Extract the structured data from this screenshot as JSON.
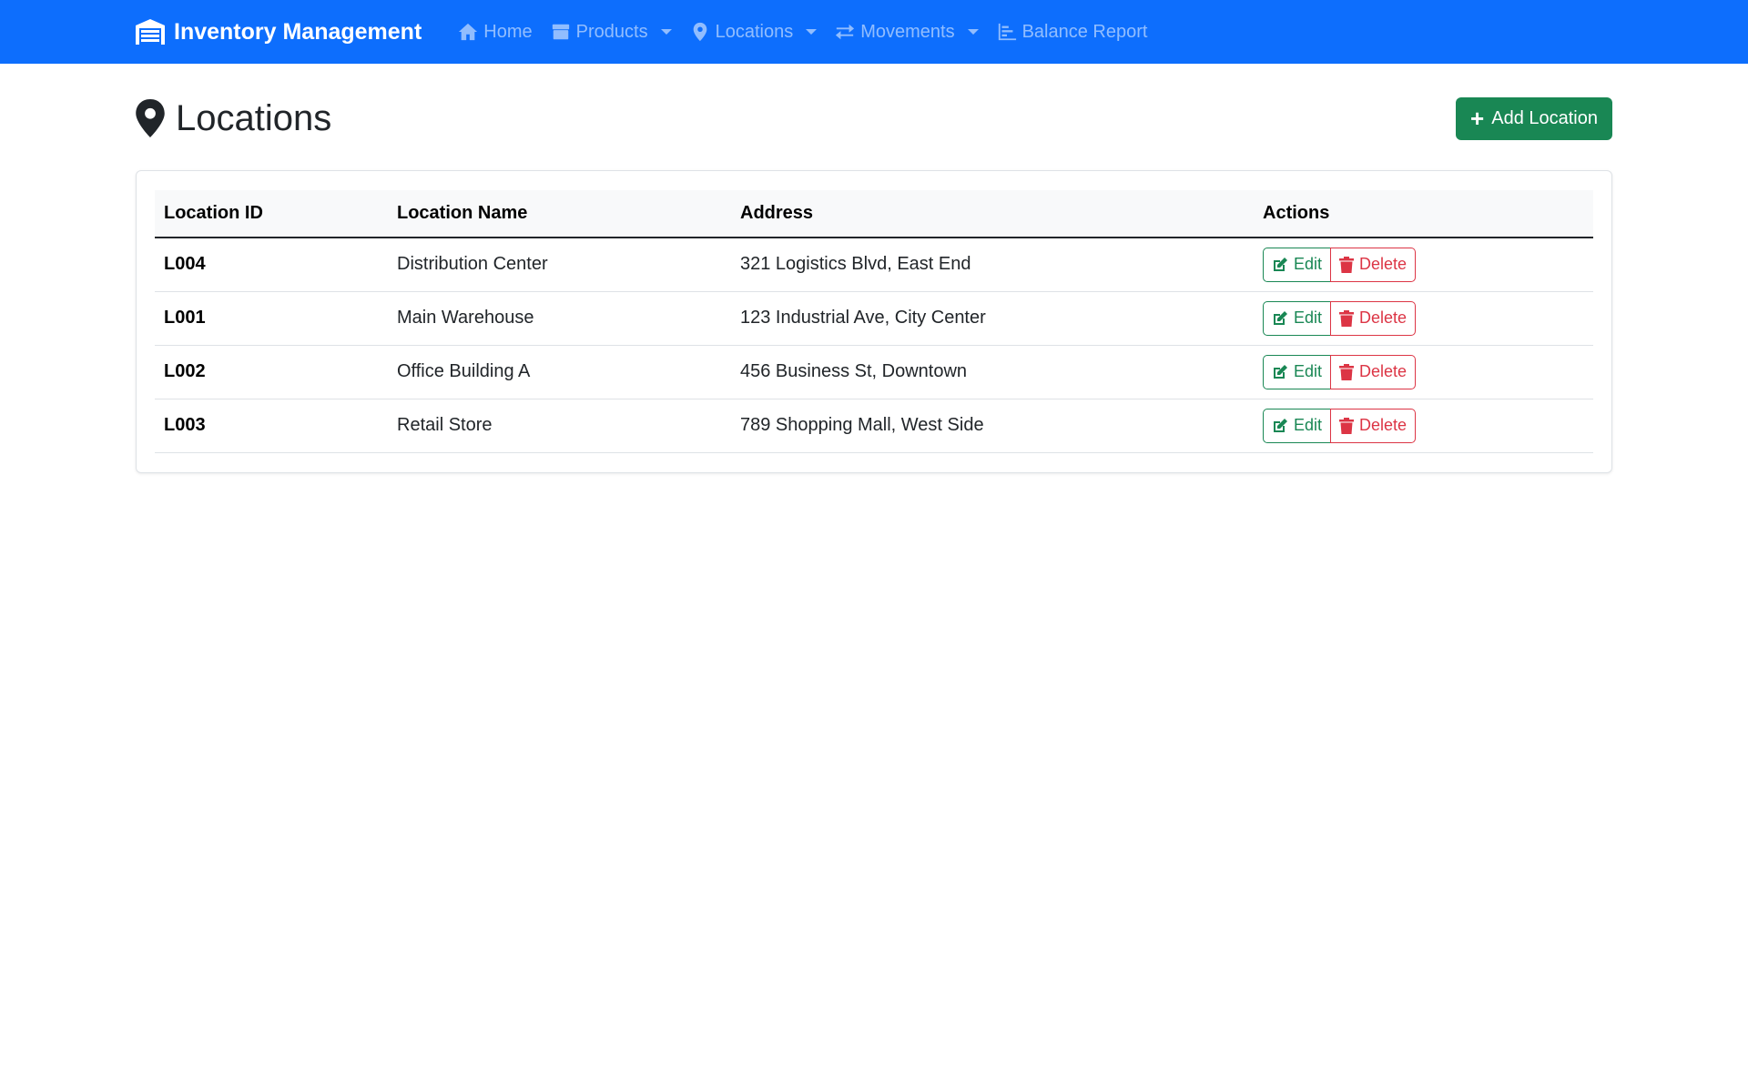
{
  "navbar": {
    "brand": "Inventory Management",
    "items": [
      {
        "label": "Home",
        "icon": "home-icon",
        "dropdown": false
      },
      {
        "label": "Products",
        "icon": "box-icon",
        "dropdown": true
      },
      {
        "label": "Locations",
        "icon": "map-pin-icon",
        "dropdown": true
      },
      {
        "label": "Movements",
        "icon": "exchange-icon",
        "dropdown": true
      },
      {
        "label": "Balance Report",
        "icon": "chart-icon",
        "dropdown": false
      }
    ]
  },
  "page": {
    "title": "Locations",
    "add_button": "Add Location"
  },
  "table": {
    "headers": [
      "Location ID",
      "Location Name",
      "Address",
      "Actions"
    ],
    "rows": [
      {
        "id": "L004",
        "name": "Distribution Center",
        "address": "321 Logistics Blvd, East End"
      },
      {
        "id": "L001",
        "name": "Main Warehouse",
        "address": "123 Industrial Ave, City Center"
      },
      {
        "id": "L002",
        "name": "Office Building A",
        "address": "456 Business St, Downtown"
      },
      {
        "id": "L003",
        "name": "Retail Store",
        "address": "789 Shopping Mall, West Side"
      }
    ],
    "edit_label": "Edit",
    "delete_label": "Delete"
  },
  "colors": {
    "primary": "#0d6efd",
    "success": "#198754",
    "danger": "#dc3545"
  }
}
